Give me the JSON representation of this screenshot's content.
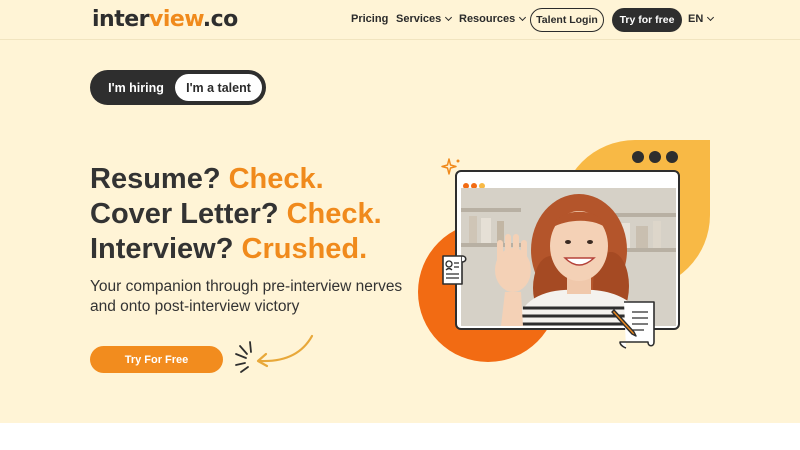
{
  "header": {
    "logo": {
      "part1": "inter",
      "part2": "view",
      "part3": ".co"
    },
    "nav": [
      {
        "label": "Pricing"
      },
      {
        "label": "Services"
      },
      {
        "label": "Resources"
      }
    ],
    "talent_login": "Talent Login",
    "try_free": "Try for free",
    "language": "EN"
  },
  "toggle": {
    "hiring": "I'm hiring",
    "talent": "I'm a talent",
    "selected": "talent"
  },
  "hero": {
    "line1_a": "Resume? ",
    "line1_b": "Check.",
    "line2_a": "Cover Letter? ",
    "line2_b": "Check.",
    "line3_a": "Interview? ",
    "line3_b": "Crushed.",
    "subtext": "Your companion through pre-interview nerves and onto post-interview victory",
    "cta": "Try For Free"
  },
  "colors": {
    "accent": "#f08a1c",
    "background": "#fff4d6",
    "dark": "#2e2e2e",
    "blob_yellow": "#f8b945",
    "blob_orange": "#f26b13"
  }
}
